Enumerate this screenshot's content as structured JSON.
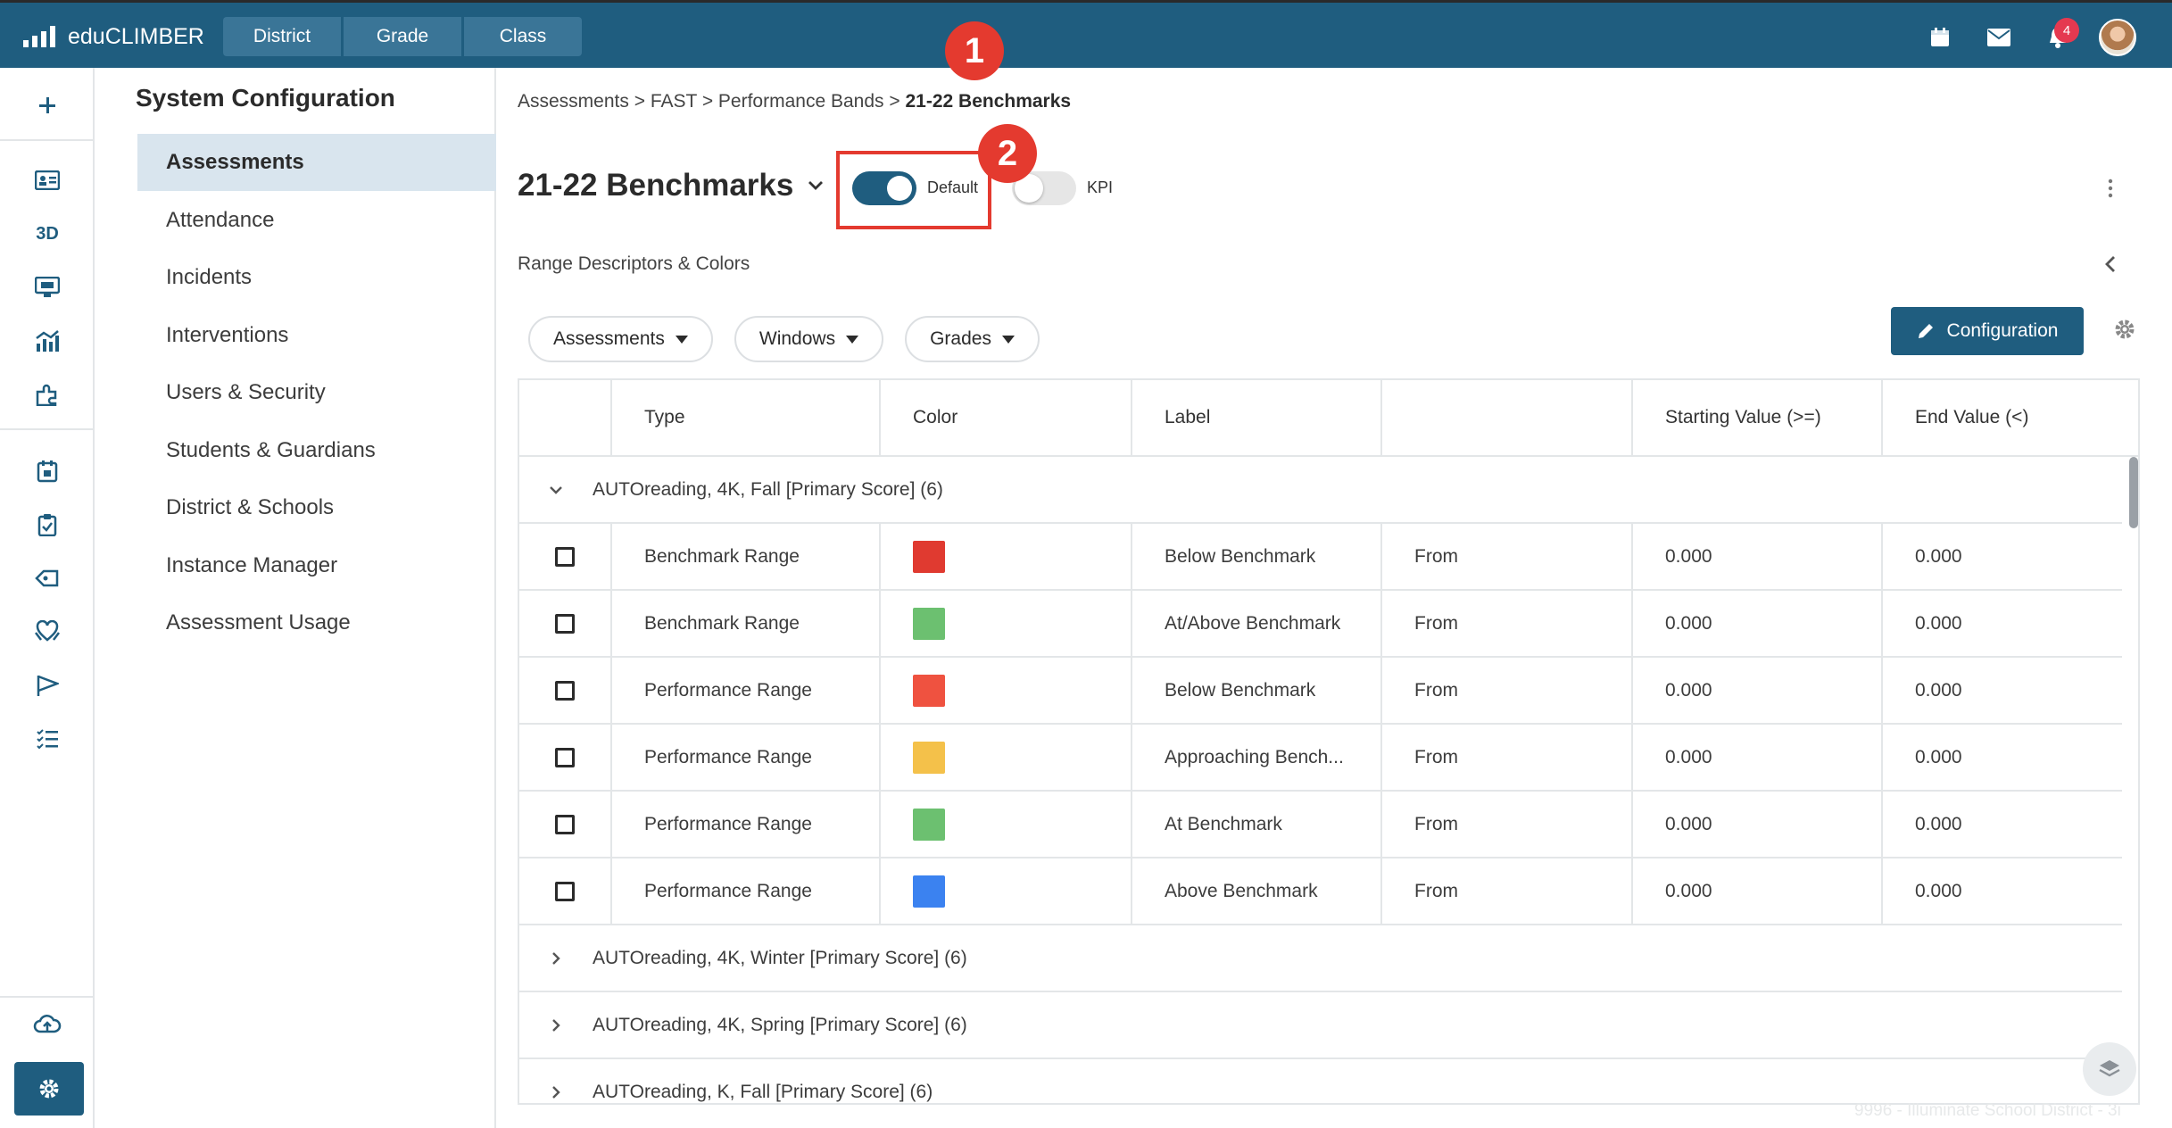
{
  "app": {
    "name": "eduCLIMBER"
  },
  "topnav": [
    "District",
    "Grade",
    "Class"
  ],
  "notifications": {
    "count": "4"
  },
  "markers": {
    "one": "1",
    "two": "2"
  },
  "rail": {
    "rail_3d_label": "3D"
  },
  "settings": {
    "title": "System Configuration",
    "items": [
      "Assessments",
      "Attendance",
      "Incidents",
      "Interventions",
      "Users & Security",
      "Students & Guardians",
      "District & Schools",
      "Instance Manager",
      "Assessment Usage"
    ],
    "active_index": 0
  },
  "breadcrumb": {
    "part1": "Assessments",
    "part2": "FAST",
    "part3": "Performance Bands",
    "current": "21-22 Benchmarks",
    "sep": ">"
  },
  "page": {
    "title": "21-22 Benchmarks",
    "toggle_default_label": "Default",
    "toggle_default_on": true,
    "toggle_kpi_label": "KPI",
    "toggle_kpi_on": false,
    "section_label": "Range Descriptors & Colors"
  },
  "filters": [
    "Assessments",
    "Windows",
    "Grades"
  ],
  "config_button": "Configuration",
  "table": {
    "headers": [
      "Type",
      "Color",
      "Label",
      "",
      "Starting Value (>=)",
      "End Value (<)"
    ],
    "groups": [
      {
        "label": "AUTOreading, 4K, Fall [Primary Score] (6)",
        "expanded": true,
        "rows": [
          {
            "type": "Benchmark Range",
            "color": "#e03a30",
            "label": "Below Benchmark",
            "from": "From",
            "start": "0.000",
            "end": "0.000"
          },
          {
            "type": "Benchmark Range",
            "color": "#6cc070",
            "label": "At/Above Benchmark",
            "from": "From",
            "start": "0.000",
            "end": "0.000"
          },
          {
            "type": "Performance Range",
            "color": "#ef5240",
            "label": "Below Benchmark",
            "from": "From",
            "start": "0.000",
            "end": "0.000"
          },
          {
            "type": "Performance Range",
            "color": "#f4c14a",
            "label": "Approaching Bench...",
            "from": "From",
            "start": "0.000",
            "end": "0.000"
          },
          {
            "type": "Performance Range",
            "color": "#6cc070",
            "label": "At Benchmark",
            "from": "From",
            "start": "0.000",
            "end": "0.000"
          },
          {
            "type": "Performance Range",
            "color": "#3b82f0",
            "label": "Above Benchmark",
            "from": "From",
            "start": "0.000",
            "end": "0.000"
          }
        ]
      },
      {
        "label": "AUTOreading, 4K, Winter [Primary Score] (6)",
        "expanded": false
      },
      {
        "label": "AUTOreading, 4K, Spring [Primary Score] (6)",
        "expanded": false
      },
      {
        "label": "AUTOreading, K, Fall [Primary Score] (6)",
        "expanded": false
      }
    ]
  },
  "watermark": "9996 - Illuminate School District - 3i",
  "colors": {
    "primary": "#1f5d7f",
    "marker": "#e43a2f",
    "active_bg": "#d9e5ee"
  }
}
